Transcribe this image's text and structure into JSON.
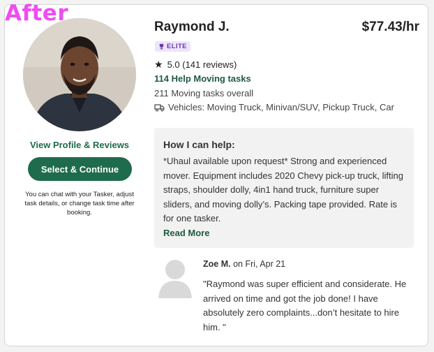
{
  "overlay_label": "After",
  "tasker": {
    "name": "Raymond J.",
    "rate": "$77.43/hr",
    "badge": "ELITE",
    "rating": "5.0 (141 reviews)",
    "category_tasks": "114 Help Moving tasks",
    "overall_tasks": "211 Moving tasks overall",
    "vehicles": "Vehicles: Moving Truck, Minivan/SUV, Pickup Truck, Car"
  },
  "left": {
    "view_profile": "View Profile & Reviews",
    "select_button": "Select & Continue",
    "note": "You can chat with your Tasker, adjust task details, or change task time after booking."
  },
  "help": {
    "title": "How I can help:",
    "body": "*Uhaul available upon request* Strong and experienced mover. Equipment includes 2020 Chevy pick-up truck, lifting straps, shoulder dolly, 4in1 hand truck, furniture super sliders, and moving dolly’s. Packing tape provided. Rate is for one tasker.",
    "read_more": "Read More"
  },
  "review": {
    "author": "Zoe M.",
    "date": "on Fri, Apr 21",
    "text": "\"Raymond was super efficient and considerate. He arrived on time and got the job done! I have absolutely zero complaints...don’t hesitate to hire him. \""
  },
  "colors": {
    "brand_green": "#1f6b4d",
    "overlay_pink": "#ee4df2",
    "badge_bg": "#efe4fb",
    "badge_text": "#6a3ba8"
  },
  "icons": {
    "rating": "star-icon",
    "badge": "trophy-icon",
    "vehicles": "truck-icon",
    "reviewer": "default-avatar-icon"
  }
}
